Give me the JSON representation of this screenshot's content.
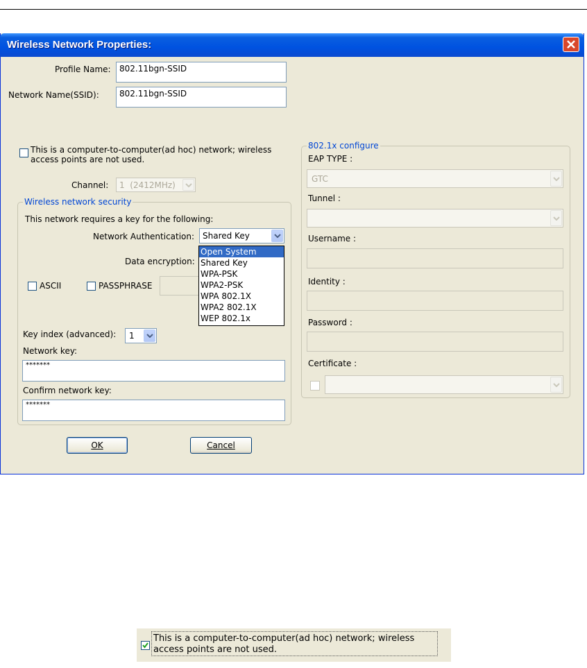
{
  "window": {
    "title": "Wireless Network Properties:"
  },
  "profile": {
    "label": "Profile Name:",
    "value": "802.11bgn-SSID"
  },
  "ssid": {
    "label": "Network Name(SSID):",
    "value": "802.11bgn-SSID"
  },
  "adhoc": {
    "line1": "This is a computer-to-computer(ad hoc) network; wireless",
    "line2": "access points are not used.",
    "checked": false
  },
  "channel": {
    "label": "Channel:",
    "value": "1  (2412MHz)"
  },
  "security": {
    "legend": "Wireless network security",
    "intro": "This network requires a key for the following:",
    "auth_label": "Network Authentication:",
    "auth_value": "Shared Key",
    "auth_options": [
      "Open System",
      "Shared Key",
      "WPA-PSK",
      "WPA2-PSK",
      "WPA 802.1X",
      "WPA2 802.1X",
      "WEP 802.1x"
    ],
    "auth_highlighted": "Open System",
    "encryption_label": "Data encryption:",
    "ascii_label": "ASCII",
    "passphrase_label": "PASSPHRASE",
    "key_index_label": "Key index (advanced):",
    "key_index_value": "1",
    "network_key_label": "Network key:",
    "network_key_value": "*******",
    "confirm_key_label": "Confirm network key:",
    "confirm_key_value": "*******"
  },
  "dot1x": {
    "legend": "802.1x configure",
    "eap_label": "EAP TYPE :",
    "eap_value": "GTC",
    "tunnel_label": "Tunnel :",
    "username_label": "Username :",
    "identity_label": "Identity :",
    "password_label": "Password :",
    "certificate_label": "Certificate :"
  },
  "buttons": {
    "ok": "OK",
    "cancel": "Cancel"
  },
  "inset": {
    "line1": "This is a computer-to-computer(ad hoc) network; wireless",
    "line2": "access points are not used.",
    "checked": true
  },
  "colors": {
    "titlebar": "#0a5fe0",
    "dialog_bg": "#ece9d8",
    "legend": "#0046d5",
    "selection": "#316ac5",
    "close": "#d9472a"
  }
}
